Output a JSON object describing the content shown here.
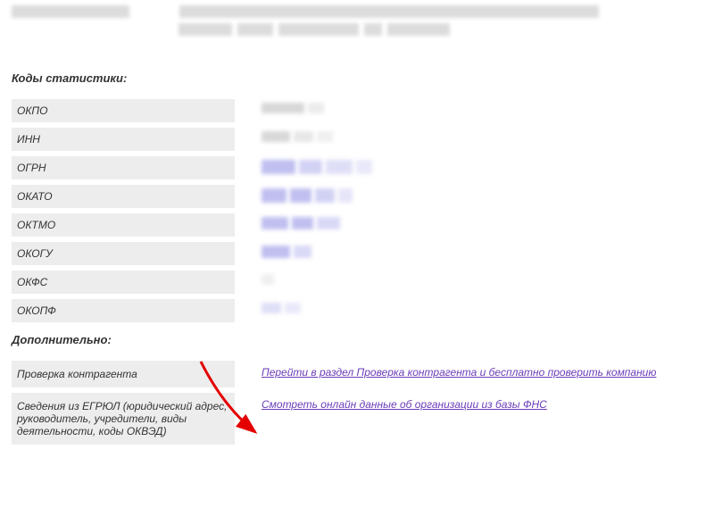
{
  "sections": {
    "stats_title": "Коды статистики:",
    "additional_title": "Дополнительно:"
  },
  "codes": {
    "okpo_label": "ОКПО",
    "inn_label": "ИНН",
    "ogrn_label": "ОГРН",
    "okato_label": "ОКАТО",
    "oktmo_label": "ОКТМО",
    "okogu_label": "ОКОГУ",
    "okfs_label": "ОКФС",
    "okopf_label": "ОКОПФ"
  },
  "additional": {
    "check_label": "Проверка контрагента",
    "check_link": "Перейти в раздел Проверка контрагента и бесплатно проверить компанию",
    "egrul_label": "Сведения из ЕГРЮЛ (юридический адрес, руководитель, учредители, виды деятельности, коды ОКВЭД)",
    "egrul_link": "Смотреть онлайн данные об организации из базы ФНС"
  }
}
